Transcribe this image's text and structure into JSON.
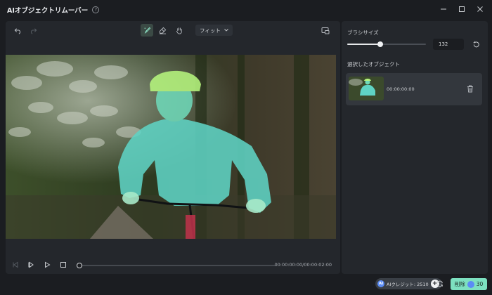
{
  "window": {
    "title": "AIオブジェクトリムーバー",
    "help_glyph": "?"
  },
  "toolbar": {
    "fit_label": "フィット"
  },
  "controls": {
    "timecode": "00:00:00:00/00:00:02:00",
    "progress": 0
  },
  "panel": {
    "brush_label": "ブラシサイズ",
    "brush_value": "132",
    "brush_level": 0.42,
    "selected_label": "選択したオブジェクト",
    "objects": [
      {
        "time": "00:00:00:00"
      }
    ]
  },
  "footer": {
    "credit_label": "AIクレジット: 2510",
    "credit_icon_text": "AI",
    "credit_plus": "+",
    "delete_label": "削除",
    "delete_cost": "30"
  },
  "colors": {
    "accent": "#7de0c0",
    "mask": "#5fe6c8",
    "background": "#1b1d21",
    "panel": "#24272c"
  }
}
